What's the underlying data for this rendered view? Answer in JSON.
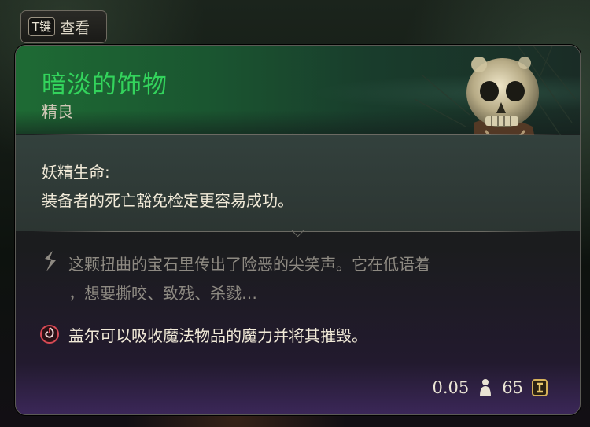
{
  "hint": {
    "key": "T键",
    "label": "查看"
  },
  "item": {
    "title": "暗淡的饰物",
    "rarity": "精良",
    "passive_name": "妖精生命:",
    "passive_desc": "装备者的死亡豁免检定更容易成功。",
    "lore_line1": "这颗扭曲的宝石里传出了险恶的尖笑声。它在低语着",
    "lore_line2": "，想要撕咬、致残、杀戮…",
    "note": "盖尔可以吸收魔法物品的魔力并将其摧毁。",
    "weight": "0.05",
    "price": "65"
  },
  "icons": {
    "portrait": "skull-amulet-icon",
    "lore": "quill-icon",
    "note": "arcane-swirl-icon",
    "weight": "weight-icon",
    "price": "gold-coin-icon"
  },
  "colors": {
    "title_green": "#33d35c",
    "rarity": "#cfc7b5",
    "body_text": "#f1ead8",
    "lore_text": "#8e8a82",
    "footer_purple": "#3b2758"
  }
}
